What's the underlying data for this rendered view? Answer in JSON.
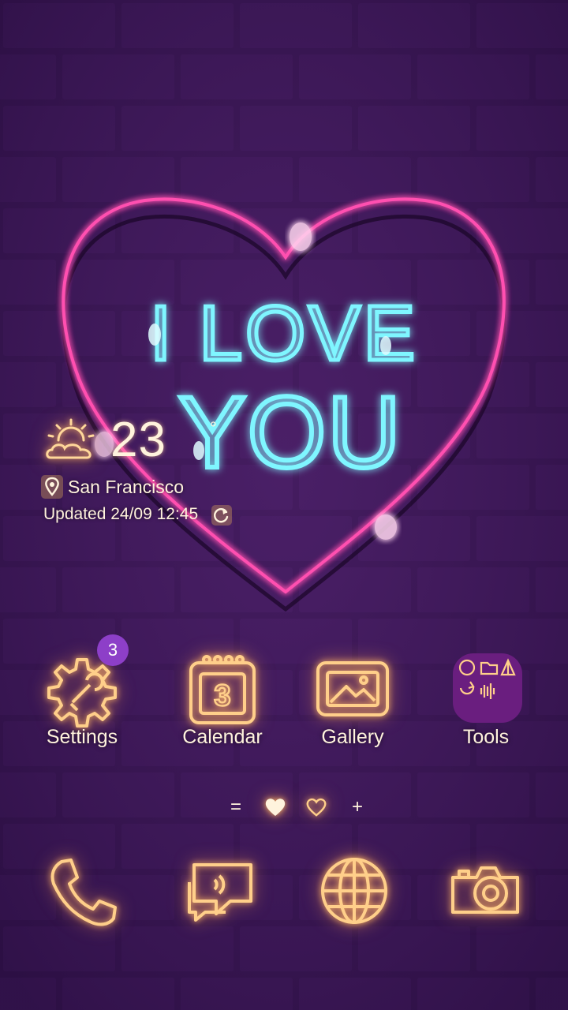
{
  "wallpaper": {
    "neon_line1": "I LOVE",
    "neon_line2": "YOU"
  },
  "weather": {
    "temperature": "23",
    "degree_symbol": "°",
    "location": "San Francisco",
    "updated": "Updated 24/09 12:45",
    "icon": "partly-cloudy-icon"
  },
  "apps": [
    {
      "label": "Settings",
      "icon": "gear-icon",
      "badge": "3"
    },
    {
      "label": "Calendar",
      "icon": "calendar-icon",
      "calendar_day": "3"
    },
    {
      "label": "Gallery",
      "icon": "gallery-icon"
    },
    {
      "label": "Tools",
      "icon": "folder-icon"
    }
  ],
  "pager": {
    "items": [
      "=",
      "heart-filled-icon",
      "heart-outline-icon",
      "+"
    ],
    "menu_glyph": "=",
    "add_glyph": "+"
  },
  "dock": [
    {
      "icon": "phone-icon"
    },
    {
      "icon": "messages-icon"
    },
    {
      "icon": "browser-globe-icon"
    },
    {
      "icon": "camera-icon"
    }
  ],
  "colors": {
    "background": "#3a1654",
    "neon_pink": "#ff4fb0",
    "neon_cyan": "#7ff6ff",
    "icon_glow": "#ffcf8a",
    "badge": "#8d3fc8",
    "folder": "#6a1e7f"
  }
}
